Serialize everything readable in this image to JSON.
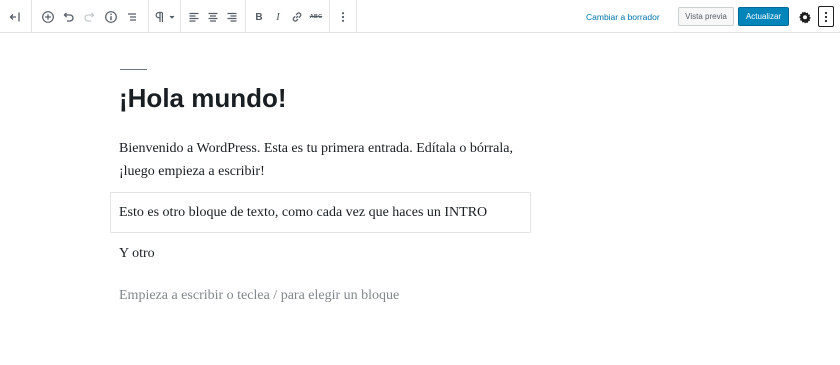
{
  "toolbar": {
    "tools": [
      {
        "name": "toggle-sidebar-icon"
      },
      {
        "name": "add-block-icon"
      },
      {
        "name": "undo-icon"
      },
      {
        "name": "redo-icon"
      },
      {
        "name": "info-icon"
      },
      {
        "name": "block-navigation-icon"
      },
      {
        "name": "paragraph-icon"
      },
      {
        "name": "align-left-icon"
      },
      {
        "name": "align-center-icon"
      },
      {
        "name": "align-right-icon"
      },
      {
        "name": "bold-icon"
      },
      {
        "name": "italic-icon"
      },
      {
        "name": "link-icon"
      },
      {
        "name": "strikethrough-icon"
      },
      {
        "name": "more-options-icon"
      },
      {
        "name": "settings-icon"
      },
      {
        "name": "main-menu-icon"
      }
    ],
    "bold_label": "B",
    "italic_label": "I",
    "strike_label": "ABC",
    "switch_to_draft": "Cambiar a borrador",
    "preview": "Vista previa",
    "update": "Actualizar"
  },
  "post": {
    "title": "¡Hola mundo!",
    "paragraphs": [
      "Bienvenido a WordPress. Esta es tu primera entrada. Edítala o bórrala, ¡luego empieza a escribir!",
      "Esto es otro bloque de texto, como cada vez que haces un INTRO",
      "Y otro"
    ],
    "placeholder": "Empieza a escribir o teclea / para elegir un bloque"
  },
  "colors": {
    "accent": "#0085ba",
    "link": "#0073aa",
    "text": "#191e23",
    "placeholder": "#82878c"
  }
}
